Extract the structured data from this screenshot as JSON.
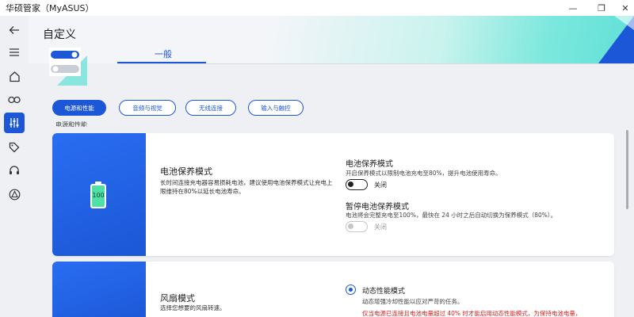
{
  "window": {
    "title": "华硕管家（MyASUS）",
    "minimize_glyph": "—",
    "maximize_glyph": "❐",
    "close_glyph": "✕"
  },
  "sidebar": {
    "items": [
      {
        "name": "back-arrow-icon",
        "active": false
      },
      {
        "name": "menu-icon",
        "active": false
      },
      {
        "name": "home-icon",
        "active": false
      },
      {
        "name": "link-icon",
        "active": false
      },
      {
        "name": "sliders-icon",
        "active": true
      },
      {
        "name": "tag-icon",
        "active": false
      },
      {
        "name": "headset-icon",
        "active": false
      },
      {
        "name": "triangle-icon",
        "active": false
      }
    ]
  },
  "page": {
    "title": "自定义",
    "tabs": [
      {
        "label": "一般",
        "selected": true
      }
    ],
    "categories": [
      {
        "label": "电源和性能",
        "active": true
      },
      {
        "label": "音频与视觉",
        "active": false
      },
      {
        "label": "无线连接",
        "active": false
      },
      {
        "label": "输入与触控",
        "active": false
      }
    ],
    "cutoff_text": "电源和性能"
  },
  "battery_card": {
    "battery_level_text": "100",
    "title": "电池保养模式",
    "description_line1": "长时间连接充电器容易损耗电池，建议使用电池保养模式让充电上",
    "description_line2": "限维持在80%以延长电池寿命。",
    "options": [
      {
        "title": "电池保养模式",
        "description": "开启保养模式以限制电池充电至80%，提升电池使用寿命。",
        "toggle_label": "关闭",
        "enabled": true,
        "on": false
      },
      {
        "title": "暂停电池保养模式",
        "description": "电池将会完整充电至100%，最快在 24 小时之后自动切换为保养模式（80%）。",
        "toggle_label": "关闭",
        "enabled": false,
        "on": false
      }
    ]
  },
  "fan_card": {
    "title": "风扇模式",
    "description": "选择您想要的风扇转速。",
    "options": [
      {
        "label": "动态性能模式",
        "description": "动态增强冷却性能以应对严苛的任务。",
        "warning": "仅当电源已连接且电池电量超过 40% 时才能启用动态性能模式，为保持电池电量，",
        "selected": true
      }
    ]
  },
  "colors": {
    "accent": "#1b57d6",
    "header_gradient_end": "#5fe0d6",
    "warning": "#d91e1e"
  }
}
